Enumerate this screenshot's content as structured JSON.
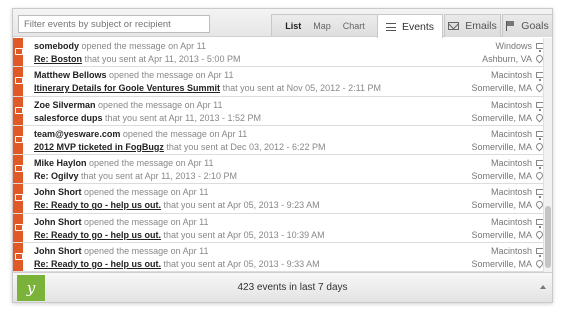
{
  "search": {
    "placeholder": "Filter events by subject or recipient"
  },
  "views": [
    "List",
    "Map",
    "Chart"
  ],
  "tabs": {
    "events": "Events",
    "emails": "Emails",
    "goals": "Goals"
  },
  "events": [
    {
      "who": "somebody",
      "verb": "opened",
      "mid": "the message on Apr 11",
      "subject": "Re: Boston",
      "sent": "that you sent at Apr 11, 2013 - 5:00 PM",
      "os": "Windows",
      "location": "Ashburn, VA",
      "underlined": true
    },
    {
      "who": "Matthew Bellows",
      "verb": "opened",
      "mid": "the message on Apr 11",
      "subject": "Itinerary Details for Goole Ventures Summit",
      "sent": "that you sent at Nov 05, 2012 - 2:11 PM",
      "os": "Macintosh",
      "location": "Somerville, MA",
      "underlined": true
    },
    {
      "who": "Zoe Silverman",
      "verb": "opened",
      "mid": "the message on Apr 11",
      "subject": "salesforce dups",
      "sent": "that you sent at Apr 11, 2013 - 1:52 PM",
      "os": "Macintosh",
      "location": "Somerville, MA",
      "underlined": false
    },
    {
      "who": "team@yesware.com",
      "verb": "opened",
      "mid": "the message on Apr 11",
      "subject": "2012 MVP ticketed in FogBugz",
      "sent": "that you sent at Dec 03, 2012 - 6:22 PM",
      "os": "Macintosh",
      "location": "Somerville, MA",
      "underlined": true
    },
    {
      "who": "Mike Haylon",
      "verb": "opened",
      "mid": "the message on Apr 11",
      "subject": "Re: Ogilvy",
      "sent": "that you sent at Apr 11, 2013 - 2:10 PM",
      "os": "Macintosh",
      "location": "Somerville, MA",
      "underlined": false
    },
    {
      "who": "John Short",
      "verb": "opened",
      "mid": "the message on Apr 11",
      "subject": "Re: Ready to go - help us out.",
      "sent": "that you sent at Apr 05, 2013 - 9:23 AM",
      "os": "Macintosh",
      "location": "Somerville, MA",
      "underlined": true
    },
    {
      "who": "John Short",
      "verb": "opened",
      "mid": "the message on Apr 11",
      "subject": "Re: Ready to go - help us out.",
      "sent": "that you sent at Apr 05, 2013 - 10:39 AM",
      "os": "Macintosh",
      "location": "Somerville, MA",
      "underlined": true
    },
    {
      "who": "John Short",
      "verb": "opened",
      "mid": "the message on Apr 11",
      "subject": "Re: Ready to go - help us out.",
      "sent": "that you sent at Apr 05, 2013 - 9:33 AM",
      "os": "Macintosh",
      "location": "Somerville, MA",
      "underlined": true
    }
  ],
  "footer": {
    "logo": "y",
    "count_text": "423 events in last 7 days"
  },
  "colors": {
    "accent": "#e05a28",
    "brand": "#7ab23a"
  },
  "icons": {
    "row": "envelope-icon",
    "os": "monitor-icon",
    "location": "map-pin-icon"
  }
}
